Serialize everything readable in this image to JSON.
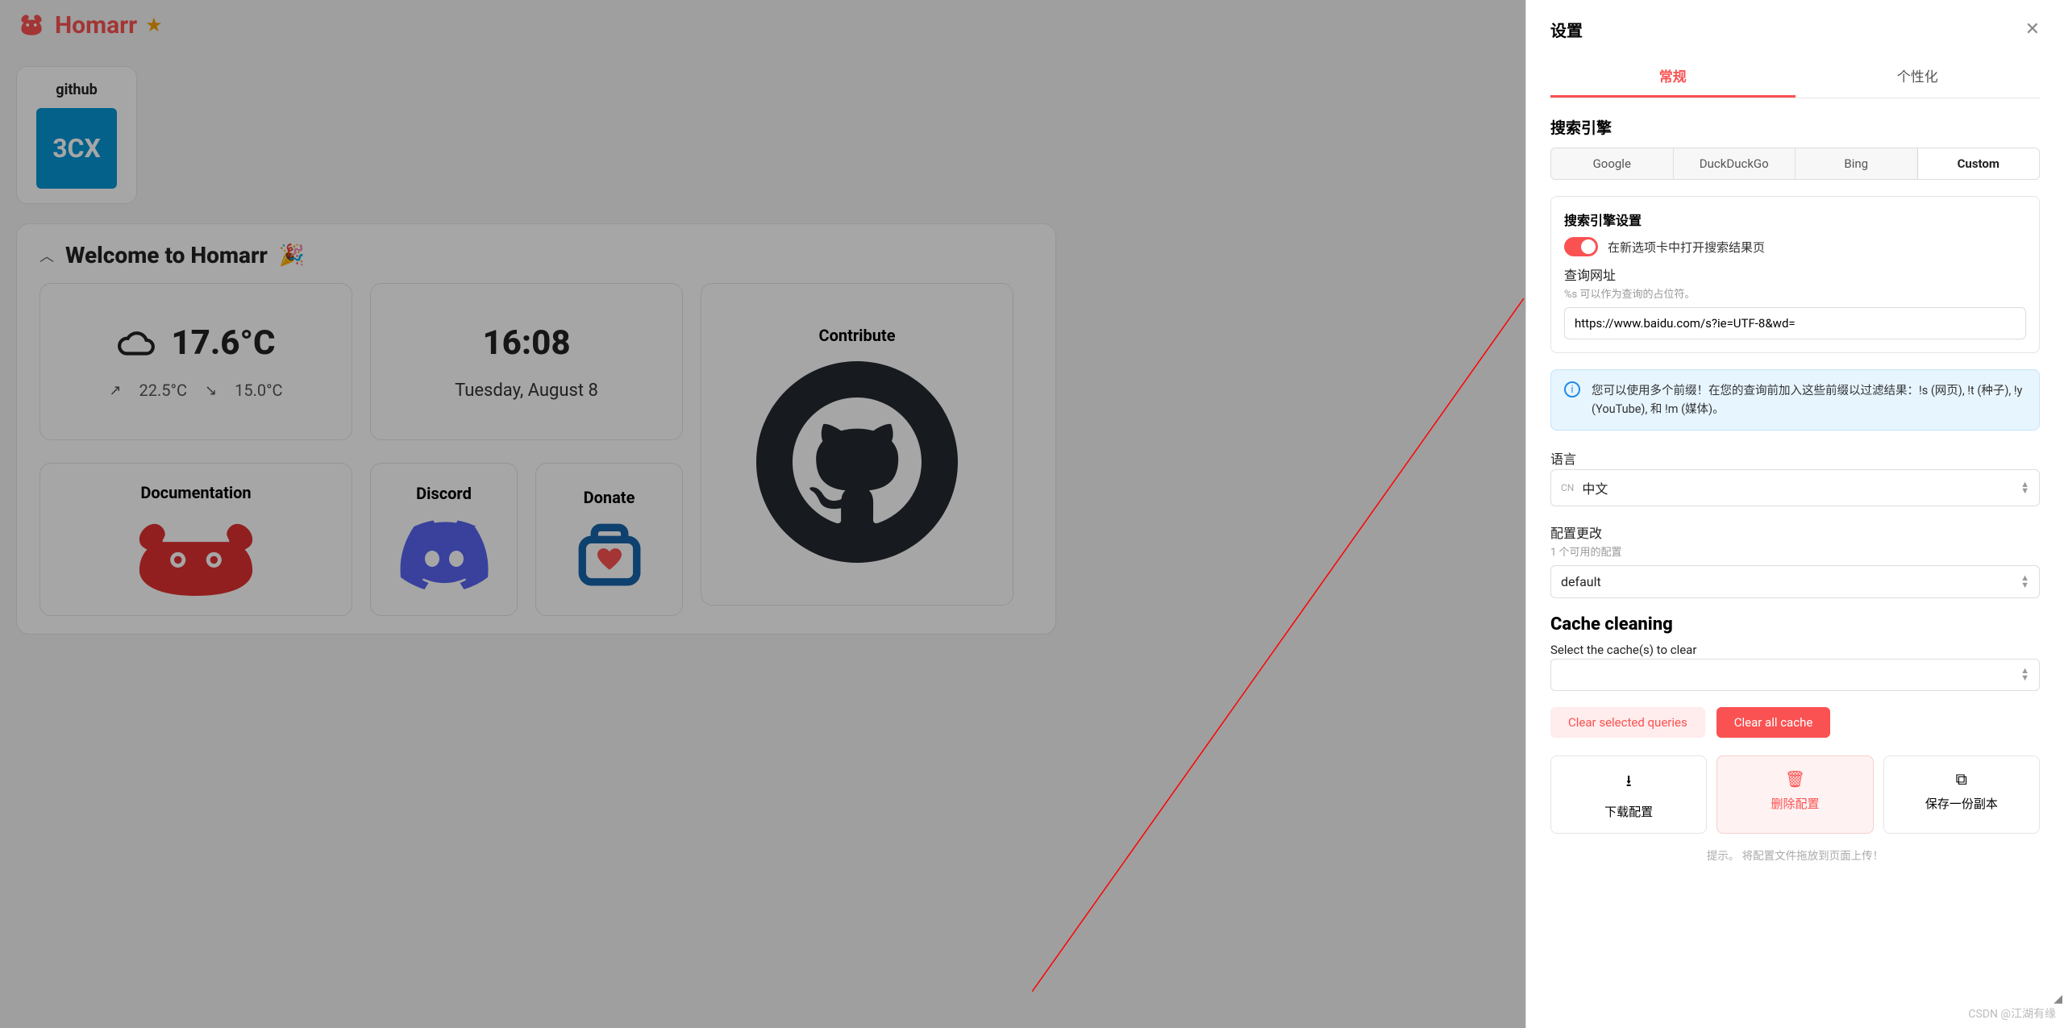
{
  "brand": "Homarr",
  "app_tile": {
    "label": "github",
    "badge": "3CX"
  },
  "welcome": {
    "title": "Welcome to Homarr",
    "weather": {
      "temp": "17.6°C",
      "high": "22.5°C",
      "low": "15.0°C"
    },
    "clock": {
      "time": "16:08",
      "date": "Tuesday, August 8"
    },
    "contribute": "Contribute",
    "documentation": "Documentation",
    "discord": "Discord",
    "donate": "Donate"
  },
  "panel": {
    "title": "设置",
    "tabs": {
      "general": "常规",
      "personalize": "个性化"
    },
    "search_engine": {
      "heading": "搜索引擎",
      "options": [
        "Google",
        "DuckDuckGo",
        "Bing",
        "Custom"
      ],
      "selected": "Custom",
      "settings_heading": "搜索引擎设置",
      "toggle_label": "在新选项卡中打开搜索结果页",
      "url_label": "查询网址",
      "url_hint": "%s 可以作为查询的占位符。",
      "url_value": "https://www.baidu.com/s?ie=UTF-8&wd=",
      "info": "您可以使用多个前缀！在您的查询前加入这些前缀以过滤结果：!s (网页), !t (种子), !y (YouTube), 和 !m (媒体)。"
    },
    "language": {
      "label": "语言",
      "prefix": "CN",
      "value": "中文"
    },
    "config": {
      "label": "配置更改",
      "hint": "1 个可用的配置",
      "value": "default"
    },
    "cache": {
      "heading": "Cache cleaning",
      "select_label": "Select the cache(s) to clear",
      "clear_selected": "Clear selected queries",
      "clear_all": "Clear all cache"
    },
    "actions": {
      "download": "下载配置",
      "delete": "删除配置",
      "copy": "保存一份副本"
    },
    "tip": "提示。 将配置文件拖放到页面上传！"
  },
  "watermark": "CSDN @江湖有缘"
}
